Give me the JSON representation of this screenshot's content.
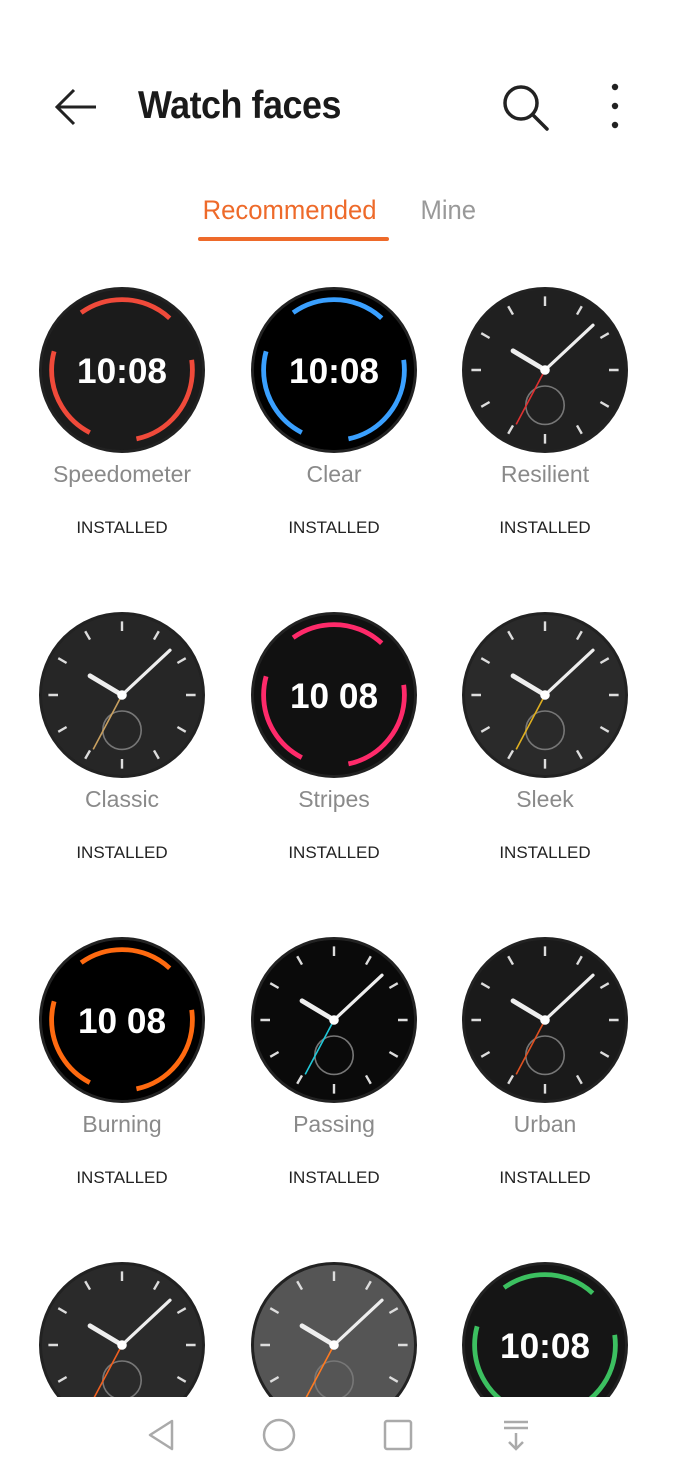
{
  "header": {
    "title": "Watch faces",
    "back_icon": "arrow-left-icon",
    "search_icon": "search-icon",
    "more_icon": "more-vertical-icon"
  },
  "tabs": [
    {
      "label": "Recommended",
      "active": true
    },
    {
      "label": "Mine",
      "active": false
    }
  ],
  "colors": {
    "accent": "#ee6a2a"
  },
  "faces": [
    {
      "name": "Speedometer",
      "status": "INSTALLED",
      "time": "10:08",
      "style": "digital",
      "bg": "#1b1b1b",
      "accent": "#f04a3a"
    },
    {
      "name": "Clear",
      "status": "INSTALLED",
      "time": "10:08",
      "style": "digital",
      "bg": "#000000",
      "accent": "#3aa0ff"
    },
    {
      "name": "Resilient",
      "status": "INSTALLED",
      "time": "",
      "style": "analog",
      "bg": "#202020",
      "accent": "#e03030"
    },
    {
      "name": "Classic",
      "status": "INSTALLED",
      "time": "",
      "style": "analog",
      "bg": "#262626",
      "accent": "#c8a060"
    },
    {
      "name": "Stripes",
      "status": "INSTALLED",
      "time": "10 08",
      "style": "digital",
      "bg": "#111111",
      "accent": "#ff2a6a"
    },
    {
      "name": "Sleek",
      "status": "INSTALLED",
      "time": "",
      "style": "analog",
      "bg": "#2a2a2a",
      "accent": "#e0b020"
    },
    {
      "name": "Burning",
      "status": "INSTALLED",
      "time": "10 08",
      "style": "digital",
      "bg": "#000000",
      "accent": "#ff6a10"
    },
    {
      "name": "Passing",
      "status": "INSTALLED",
      "time": "",
      "style": "analog",
      "bg": "#0a0a0a",
      "accent": "#20c8d8"
    },
    {
      "name": "Urban",
      "status": "INSTALLED",
      "time": "",
      "style": "analog",
      "bg": "#1a1a1a",
      "accent": "#e05020"
    },
    {
      "name": "",
      "status": "",
      "time": "",
      "style": "analog",
      "bg": "#2a2a2a",
      "accent": "#f06020"
    },
    {
      "name": "",
      "status": "",
      "time": "",
      "style": "analog",
      "bg": "#555555",
      "accent": "#ff7a20"
    },
    {
      "name": "",
      "status": "",
      "time": "10:08",
      "style": "digital",
      "bg": "#151515",
      "accent": "#3cc060"
    }
  ],
  "nav": {
    "back_icon": "triangle-back-icon",
    "home_icon": "circle-home-icon",
    "recents_icon": "square-recents-icon",
    "notification_icon": "pull-down-icon"
  }
}
